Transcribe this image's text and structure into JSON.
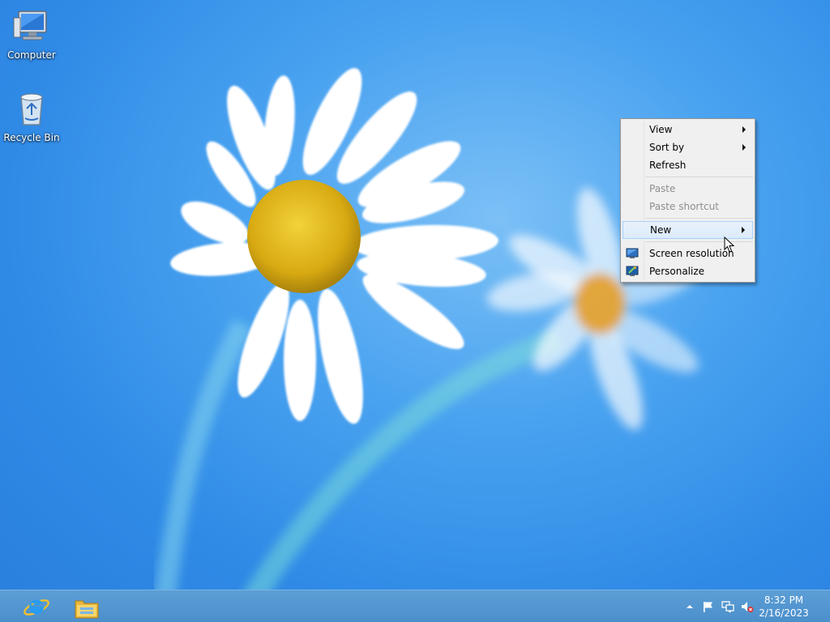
{
  "desktop": {
    "icons": [
      {
        "label": "Computer",
        "icon": "computer-icon"
      },
      {
        "label": "Recycle Bin",
        "icon": "recycle-bin-icon"
      }
    ]
  },
  "context_menu": {
    "items": [
      {
        "label": "View",
        "submenu": true,
        "enabled": true
      },
      {
        "label": "Sort by",
        "submenu": true,
        "enabled": true
      },
      {
        "label": "Refresh",
        "submenu": false,
        "enabled": true
      },
      {
        "label": "Paste",
        "submenu": false,
        "enabled": false
      },
      {
        "label": "Paste shortcut",
        "submenu": false,
        "enabled": false
      },
      {
        "label": "New",
        "submenu": true,
        "enabled": true,
        "highlighted": true
      },
      {
        "label": "Screen resolution",
        "submenu": false,
        "enabled": true,
        "icon": "screen-resolution-icon"
      },
      {
        "label": "Personalize",
        "submenu": false,
        "enabled": true,
        "icon": "personalize-icon"
      }
    ]
  },
  "taskbar": {
    "pinned": [
      {
        "icon": "internet-explorer-icon"
      },
      {
        "icon": "file-explorer-icon"
      }
    ],
    "tray": [
      {
        "icon": "show-hidden-icons-icon"
      },
      {
        "icon": "action-center-flag-icon"
      },
      {
        "icon": "network-icon"
      },
      {
        "icon": "volume-muted-icon"
      }
    ],
    "clock": {
      "time": "8:32 PM",
      "date": "2/16/2023"
    }
  },
  "colors": {
    "menu_highlight": "#dcebfc",
    "taskbar": "#4b8fcb"
  }
}
